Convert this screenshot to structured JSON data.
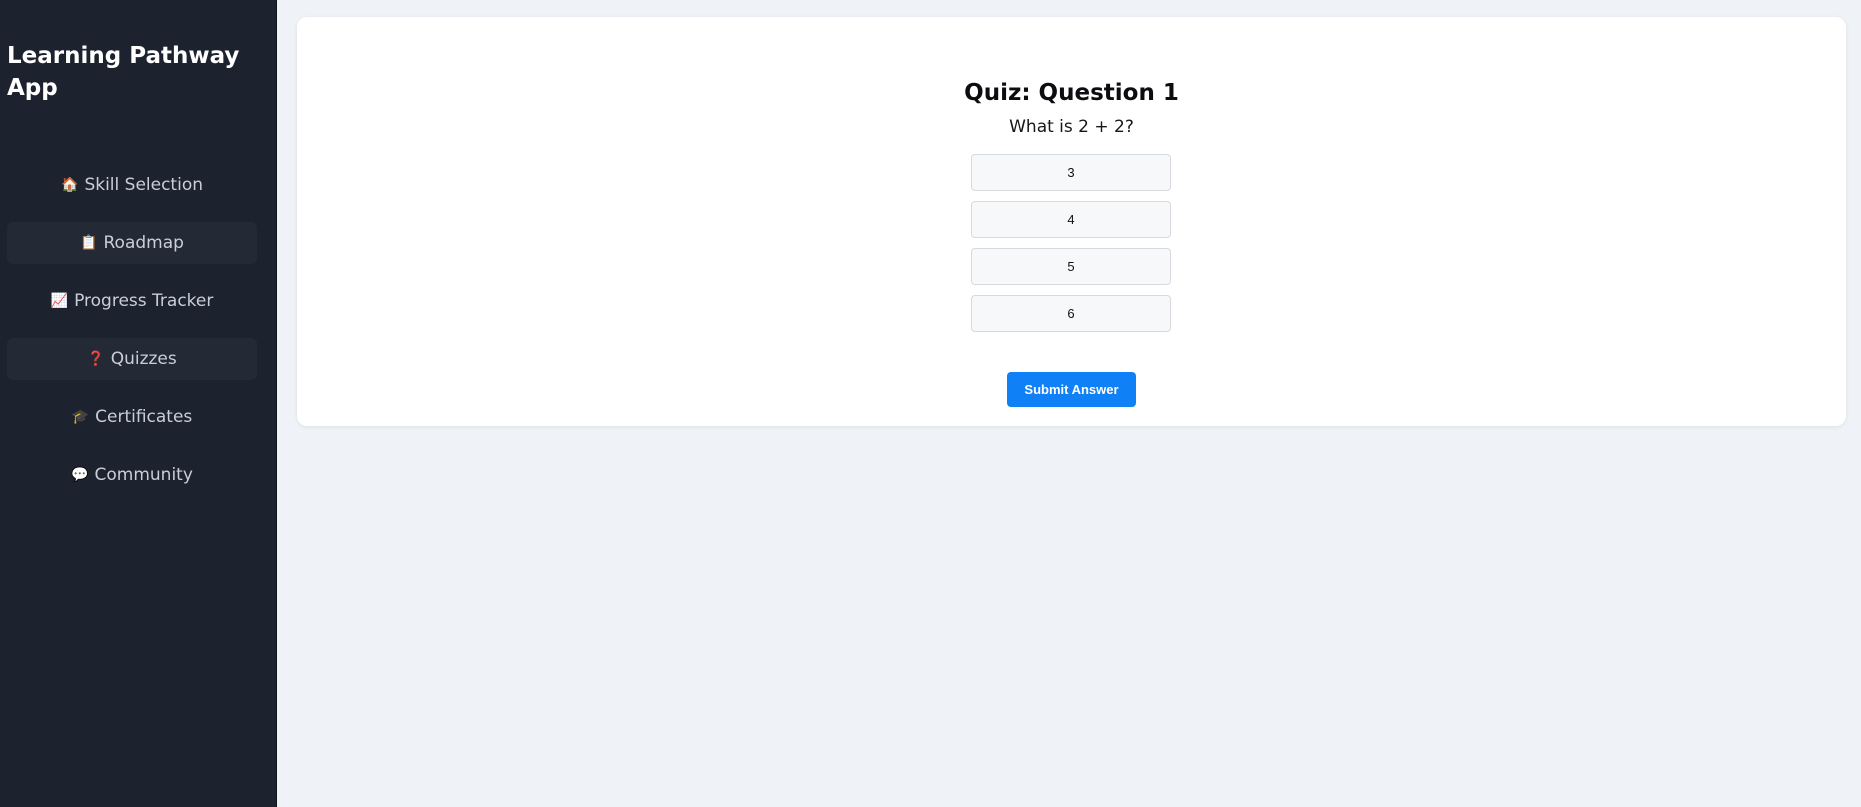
{
  "app": {
    "title": "Learning Pathway App"
  },
  "sidebar": {
    "items": [
      {
        "icon": "🏠",
        "icon_name": "house-icon",
        "label": "Skill Selection"
      },
      {
        "icon": "📋",
        "icon_name": "clipboard-icon",
        "label": "Roadmap"
      },
      {
        "icon": "📈",
        "icon_name": "chart-increasing-icon",
        "label": "Progress Tracker"
      },
      {
        "icon": "❓",
        "icon_name": "question-mark-icon",
        "label": "Quizzes"
      },
      {
        "icon": "🎓",
        "icon_name": "graduation-cap-icon",
        "label": "Certificates"
      },
      {
        "icon": "💬",
        "icon_name": "speech-bubble-icon",
        "label": "Community"
      }
    ]
  },
  "quiz": {
    "title": "Quiz: Question 1",
    "question": "What is 2 + 2?",
    "options": [
      "3",
      "4",
      "5",
      "6"
    ],
    "submit_label": "Submit Answer"
  },
  "colors": {
    "sidebar_bg": "#1c222e",
    "page_bg": "#eff2f6",
    "accent": "#0f80f5"
  }
}
